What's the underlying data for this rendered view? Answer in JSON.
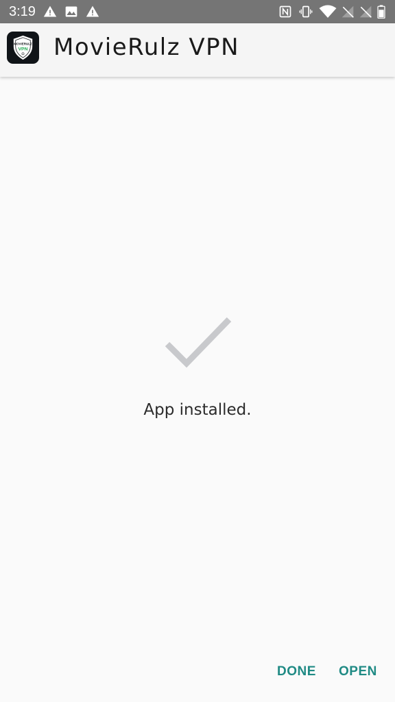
{
  "status_bar": {
    "time": "3:19",
    "icons": [
      "warning-icon",
      "image-icon",
      "warning-icon",
      "nfc-icon",
      "vibrate-icon",
      "wifi-icon",
      "signal-off-icon",
      "signal-off-icon",
      "battery-icon"
    ]
  },
  "header": {
    "app_name": "MovieRulz VPN",
    "app_icon": {
      "name": "movierulz-vpn-logo",
      "brand_text": "MOVIERULZ",
      "badge_text": "VPN"
    }
  },
  "main": {
    "status_icon": "checkmark-icon",
    "message": "App installed."
  },
  "actions": {
    "done_label": "DONE",
    "open_label": "OPEN"
  },
  "colors": {
    "status_bar": "#757575",
    "header_bg": "#f5f5f5",
    "background": "#fafafa",
    "accent": "#1f8a84",
    "checkmark": "#c8c9cc"
  }
}
